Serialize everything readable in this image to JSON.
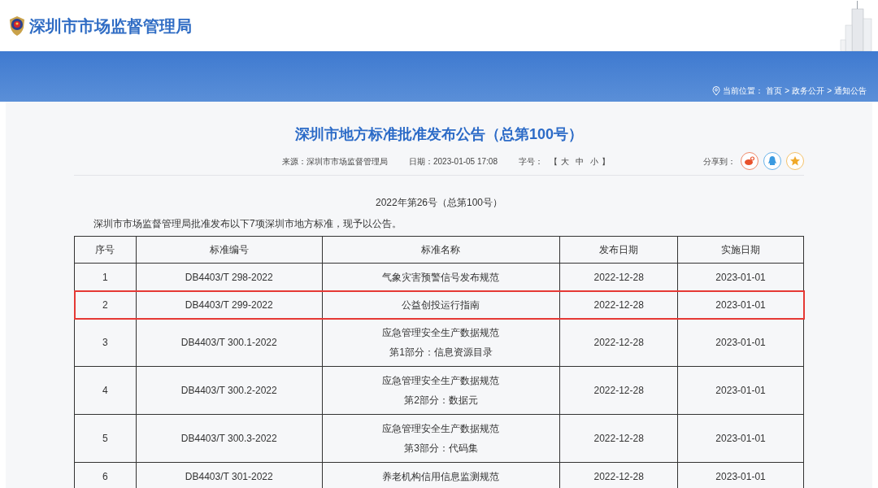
{
  "header": {
    "site_name": "深圳市市场监督管理局"
  },
  "breadcrumb": {
    "label": "当前位置：",
    "separator": ">",
    "items": [
      "首页",
      "政务公开",
      "通知公告"
    ]
  },
  "article": {
    "title": "深圳市地方标准批准发布公告（总第100号）",
    "meta": [
      {
        "label": "来源：",
        "value": "深圳市市场监督管理局"
      },
      {
        "label": "日期：",
        "value": "2023-01-05 17:08"
      }
    ],
    "font_size": {
      "label": "字号：",
      "open": "【",
      "options": [
        "大",
        "中",
        "小"
      ],
      "close": "】"
    },
    "share_label": "分享到：",
    "subtitle": "2022年第26号（总第100号）",
    "intro": "深圳市市场监督管理局批准发布以下7项深圳市地方标准，现予以公告。",
    "table": {
      "columns": [
        "序号",
        "标准编号",
        "标准名称",
        "发布日期",
        "实施日期"
      ],
      "rows": [
        {
          "no": "1",
          "code": "DB4403/T 298-2022",
          "name": [
            "气象灾害预警信号发布规范"
          ],
          "published": "2022-12-28",
          "effective": "2023-01-01",
          "highlighted": false
        },
        {
          "no": "2",
          "code": "DB4403/T 299-2022",
          "name": [
            "公益创投运行指南"
          ],
          "published": "2022-12-28",
          "effective": "2023-01-01",
          "highlighted": true
        },
        {
          "no": "3",
          "code": "DB4403/T 300.1-2022",
          "name": [
            "应急管理安全生产数据规范",
            "第1部分：信息资源目录"
          ],
          "published": "2022-12-28",
          "effective": "2023-01-01",
          "highlighted": false
        },
        {
          "no": "4",
          "code": "DB4403/T 300.2-2022",
          "name": [
            "应急管理安全生产数据规范",
            "第2部分：数据元"
          ],
          "published": "2022-12-28",
          "effective": "2023-01-01",
          "highlighted": false
        },
        {
          "no": "5",
          "code": "DB4403/T 300.3-2022",
          "name": [
            "应急管理安全生产数据规范",
            "第3部分：代码集"
          ],
          "published": "2022-12-28",
          "effective": "2023-01-01",
          "highlighted": false
        },
        {
          "no": "6",
          "code": "DB4403/T 301-2022",
          "name": [
            "养老机构信用信息监测规范"
          ],
          "published": "2022-12-28",
          "effective": "2023-01-01",
          "highlighted": false
        }
      ]
    }
  }
}
